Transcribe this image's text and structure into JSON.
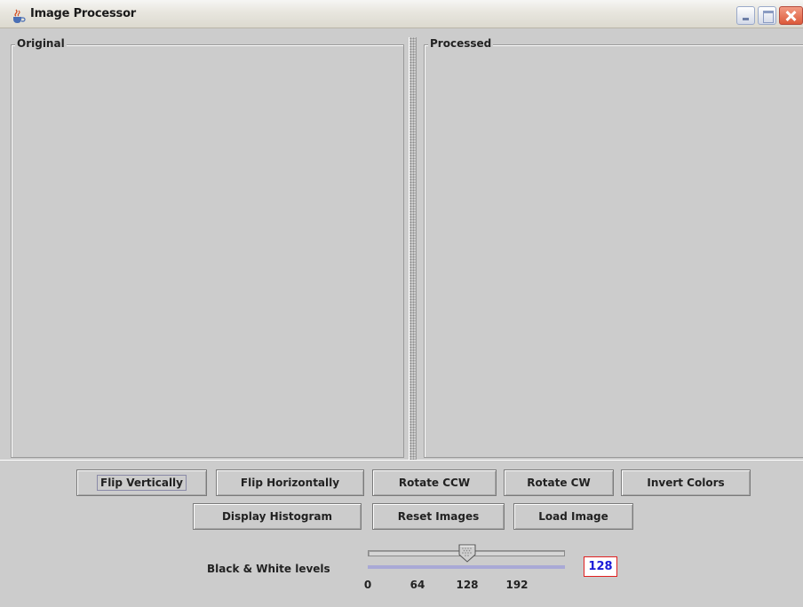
{
  "window": {
    "title": "Image Processor",
    "icon": "java-cup-icon"
  },
  "panes": {
    "left_title": "Original",
    "right_title": "Processed"
  },
  "buttons": {
    "row1": [
      "Flip Vertically",
      "Flip Horizontally",
      "Rotate CCW",
      "Rotate CW",
      "Invert Colors"
    ],
    "row2": [
      "Display Histogram",
      "Reset Images",
      "Load Image"
    ]
  },
  "slider": {
    "label": "Black & White levels",
    "min": 0,
    "max": 255,
    "value": 128,
    "tick_labels": [
      "0",
      "64",
      "128",
      "192"
    ],
    "value_display": "128"
  },
  "colors": {
    "panel_bg": "#cccccc",
    "value_text": "#1a1ad8",
    "value_border": "#e02020"
  }
}
